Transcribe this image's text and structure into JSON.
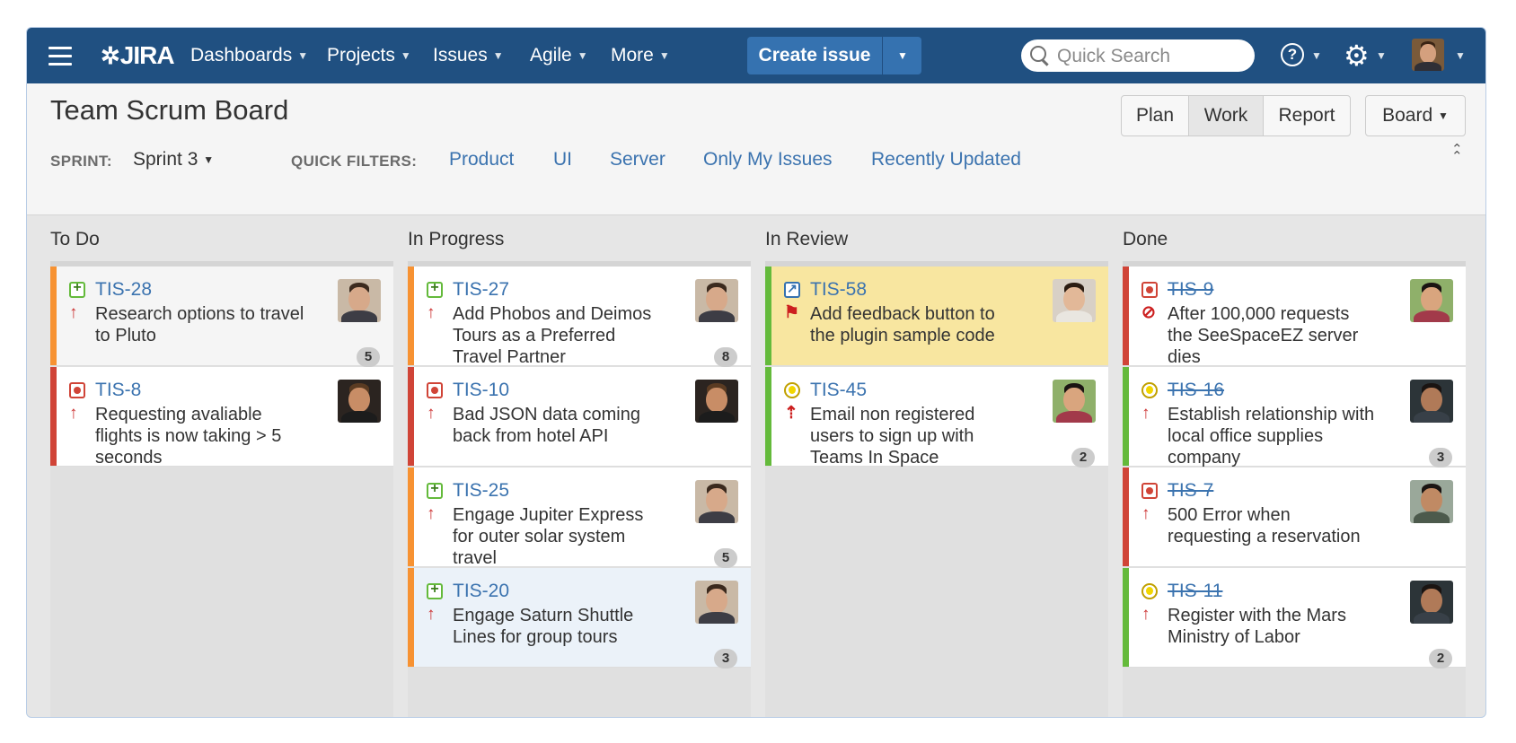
{
  "nav": {
    "app_name": "JIRA",
    "items": [
      {
        "label": "Dashboards"
      },
      {
        "label": "Projects"
      },
      {
        "label": "Issues"
      },
      {
        "label": "Agile"
      },
      {
        "label": "More"
      }
    ],
    "create_label": "Create issue",
    "search_placeholder": "Quick Search"
  },
  "header": {
    "title": "Team Scrum Board",
    "modes": [
      "Plan",
      "Work",
      "Report"
    ],
    "active_mode": "Work",
    "board_label": "Board",
    "sprint_label": "SPRINT:",
    "sprint_value": "Sprint 3",
    "quick_filters_label": "QUICK FILTERS:",
    "quick_filters": [
      "Product",
      "UI",
      "Server",
      "Only My Issues",
      "Recently Updated"
    ]
  },
  "colors": {
    "nav_bg": "#205081",
    "link": "#3b73af",
    "stripe_orange": "#f79232",
    "stripe_red": "#d04437",
    "stripe_green": "#64ba3b",
    "card_selected": "#f8e6a0",
    "card_highlight": "#ebf2f9"
  },
  "columns": [
    {
      "name": "To Do",
      "cards": [
        {
          "key": "TIS-28",
          "type": "story",
          "type_icon": "story-icon",
          "priority": "major",
          "priority_icon": "arrow-up-icon",
          "summary_lines": [
            "Research options to travel",
            "to Pluto"
          ],
          "badge": "5",
          "stripe": "#f79232",
          "bg": "#f5f5f5",
          "done": false,
          "avatar": "man-1"
        },
        {
          "key": "TIS-8",
          "type": "bug",
          "type_icon": "bug-icon",
          "priority": "major",
          "priority_icon": "arrow-up-icon",
          "summary_lines": [
            "Requesting avaliable",
            "flights is now taking > 5",
            "seconds"
          ],
          "badge": "",
          "stripe": "#d04437",
          "bg": "#ffffff",
          "done": false,
          "avatar": "man-2"
        }
      ]
    },
    {
      "name": "In Progress",
      "cards": [
        {
          "key": "TIS-27",
          "type": "story",
          "type_icon": "story-icon",
          "priority": "major",
          "priority_icon": "arrow-up-icon",
          "summary_lines": [
            "Add Phobos and Deimos",
            "Tours as a Preferred",
            "Travel Partner"
          ],
          "badge": "8",
          "stripe": "#f79232",
          "bg": "#ffffff",
          "done": false,
          "avatar": "man-1"
        },
        {
          "key": "TIS-10",
          "type": "bug",
          "type_icon": "bug-icon",
          "priority": "major",
          "priority_icon": "arrow-up-icon",
          "summary_lines": [
            "Bad JSON data coming",
            "back from hotel API"
          ],
          "badge": "",
          "stripe": "#d04437",
          "bg": "#ffffff",
          "done": false,
          "avatar": "man-2"
        },
        {
          "key": "TIS-25",
          "type": "story",
          "type_icon": "story-icon",
          "priority": "major",
          "priority_icon": "arrow-up-icon",
          "summary_lines": [
            "Engage Jupiter Express",
            "for outer solar system",
            "travel"
          ],
          "badge": "5",
          "stripe": "#f79232",
          "bg": "#ffffff",
          "done": false,
          "avatar": "man-1"
        },
        {
          "key": "TIS-20",
          "type": "story",
          "type_icon": "story-icon",
          "priority": "major",
          "priority_icon": "arrow-up-icon",
          "summary_lines": [
            "Engage Saturn Shuttle",
            "Lines for group tours"
          ],
          "badge": "3",
          "stripe": "#f79232",
          "bg": "#ebf2f9",
          "done": false,
          "avatar": "man-1"
        }
      ]
    },
    {
      "name": "In Review",
      "cards": [
        {
          "key": "TIS-58",
          "type": "improvement",
          "type_icon": "improvement-icon",
          "priority": "blocker",
          "priority_icon": "blocker-flag-icon",
          "summary_lines": [
            "Add feedback button to",
            "the plugin sample code"
          ],
          "badge": "",
          "stripe": "#64ba3b",
          "bg": "#f8e6a0",
          "done": false,
          "avatar": "man-3"
        },
        {
          "key": "TIS-45",
          "type": "idea",
          "type_icon": "lightbulb-icon",
          "priority": "critical",
          "priority_icon": "critical-arrow-icon",
          "summary_lines": [
            "Email non registered",
            "users to sign up with",
            "Teams In Space"
          ],
          "badge": "2",
          "stripe": "#64ba3b",
          "bg": "#ffffff",
          "done": false,
          "avatar": "woman-1"
        }
      ]
    },
    {
      "name": "Done",
      "cards": [
        {
          "key": "TIS-9",
          "type": "bug",
          "type_icon": "bug-icon",
          "priority": "blocker",
          "priority_icon": "blocked-circle-icon",
          "summary_lines": [
            "After 100,000 requests",
            "the SeeSpaceEZ server",
            "dies"
          ],
          "badge": "",
          "stripe": "#d04437",
          "bg": "#ffffff",
          "done": true,
          "avatar": "woman-1"
        },
        {
          "key": "TIS-16",
          "type": "idea",
          "type_icon": "lightbulb-icon",
          "priority": "major",
          "priority_icon": "arrow-up-icon",
          "summary_lines": [
            "Establish relationship with",
            "local office supplies",
            "company"
          ],
          "badge": "3",
          "stripe": "#64ba3b",
          "bg": "#ffffff",
          "done": true,
          "avatar": "man-4"
        },
        {
          "key": "TIS-7",
          "type": "bug",
          "type_icon": "bug-icon",
          "priority": "major",
          "priority_icon": "arrow-up-icon",
          "summary_lines": [
            "500 Error when",
            "requesting a reservation"
          ],
          "badge": "",
          "stripe": "#d04437",
          "bg": "#ffffff",
          "done": true,
          "avatar": "man-5"
        },
        {
          "key": "TIS-11",
          "type": "idea",
          "type_icon": "lightbulb-icon",
          "priority": "major",
          "priority_icon": "arrow-up-icon",
          "summary_lines": [
            "Register with the Mars",
            "Ministry of Labor"
          ],
          "badge": "2",
          "stripe": "#64ba3b",
          "bg": "#ffffff",
          "done": true,
          "avatar": "man-4"
        }
      ]
    }
  ]
}
